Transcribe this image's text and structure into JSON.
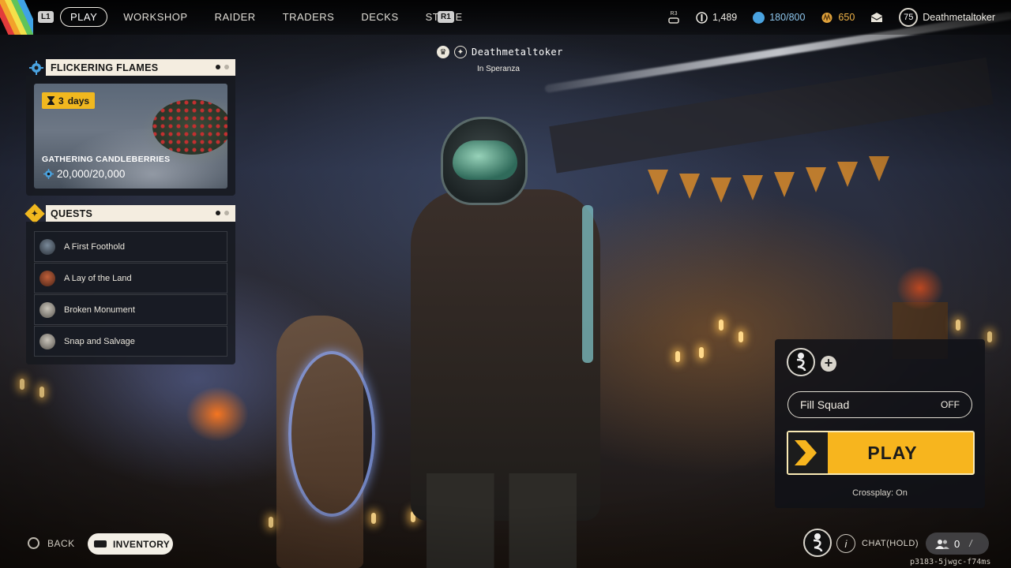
{
  "nav": {
    "left_hint": "L1",
    "right_hint": "R1",
    "items": [
      {
        "label": "PLAY"
      },
      {
        "label": "WORKSHOP"
      },
      {
        "label": "RAIDER"
      },
      {
        "label": "TRADERS"
      },
      {
        "label": "DECKS"
      },
      {
        "label": "STORE"
      }
    ],
    "active_index": 0
  },
  "stats": {
    "r3_hint": "R3",
    "currency_1": "1,489",
    "currency_2": "180/800",
    "currency_3": "650",
    "level": "75",
    "username": "Deathmetaltoker"
  },
  "player_tag": {
    "name": "Deathmetaltoker",
    "location": "In Speranza"
  },
  "event": {
    "header": "FLICKERING FLAMES",
    "timer_value": "3",
    "timer_unit": "days",
    "title": "GATHERING CANDLEBERRIES",
    "progress": "20,000/20,000"
  },
  "quests": {
    "header": "QUESTS",
    "items": [
      {
        "label": "A First Foothold"
      },
      {
        "label": "A Lay of the Land"
      },
      {
        "label": "Broken Monument"
      },
      {
        "label": "Snap and Salvage"
      }
    ]
  },
  "squad": {
    "add_symbol": "+",
    "fill_squad_label": "Fill Squad",
    "fill_squad_state": "OFF",
    "play_label": "PLAY",
    "crossplay": "Crossplay: On"
  },
  "bottom": {
    "back_label": "BACK",
    "inventory_label": "INVENTORY",
    "chat_label": "CHAT(HOLD)",
    "chat_icon_glyph": "i",
    "friends_count": "0",
    "build": "p3183-5jwgc-f74ms"
  },
  "colors": {
    "accent_yellow": "#f7b51e",
    "panel_header_bg": "#f4ede0",
    "currency_blue": "#4aa3e0",
    "currency_orange": "#e0a23b"
  }
}
